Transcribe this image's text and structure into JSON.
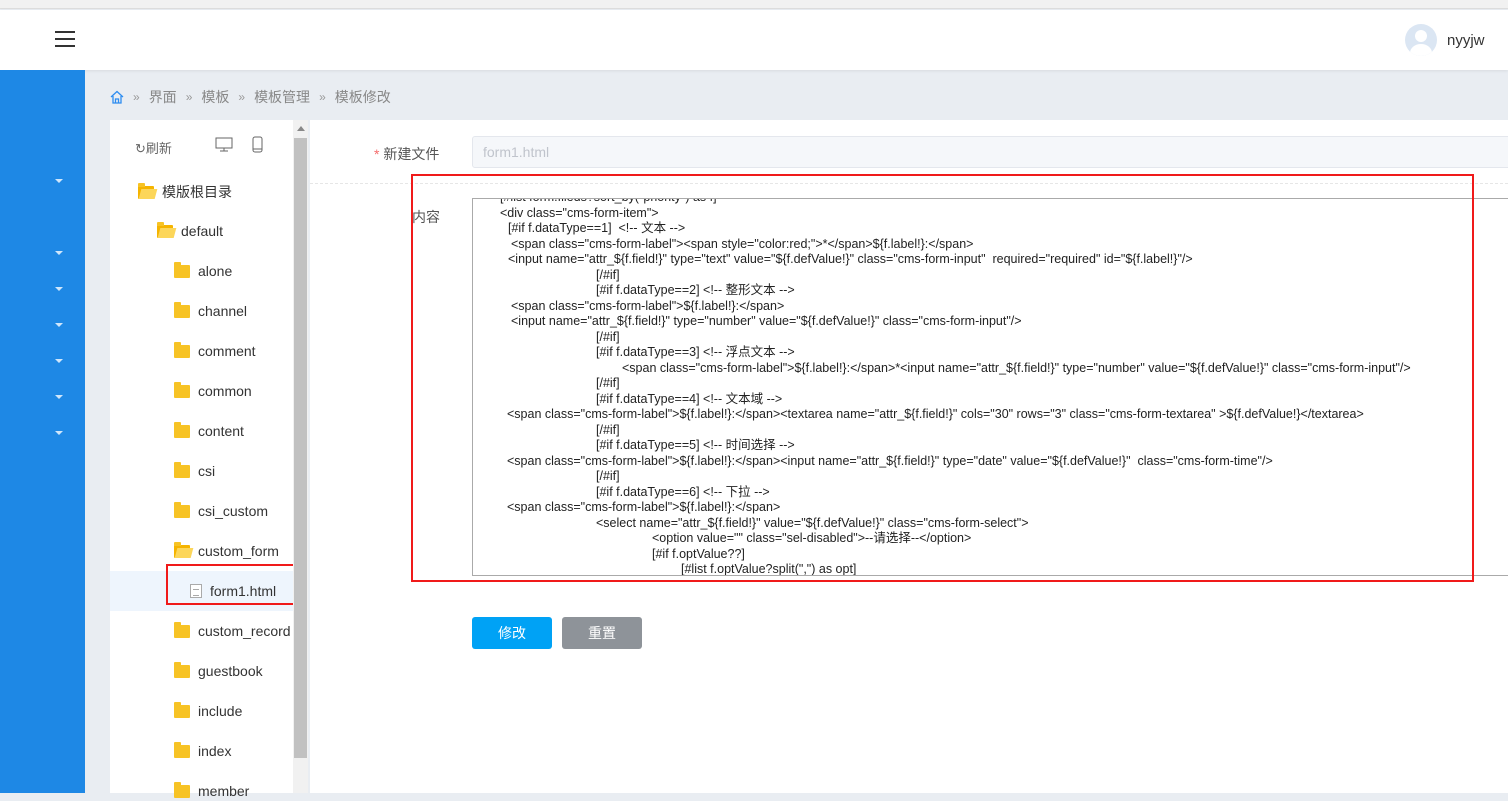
{
  "header": {
    "username": "nyyjw"
  },
  "breadcrumb": [
    "界面",
    "模板",
    "模板管理",
    "模板修改"
  ],
  "tree": {
    "refresh": "刷新",
    "root": "模版根目录",
    "default": "default",
    "items": [
      "alone",
      "channel",
      "comment",
      "common",
      "content",
      "csi",
      "csi_custom",
      "custom_form"
    ],
    "selected_file": "form1.html",
    "items_after": [
      "custom_record",
      "guestbook",
      "include",
      "index",
      "member"
    ]
  },
  "form": {
    "filename_label": "新建文件",
    "required_mark": "*",
    "filename_value": "form1.html",
    "content_label": "内容",
    "code_lines": [
      "[#list form.fileds?sort_by(\"priority\") as f]",
      "<div class=\"cms-form-item\">",
      "[#if f.dataType==1]  <!-- 文本 -->",
      "<span class=\"cms-form-label\"><span style=\"color:red;\">*</span>${f.label!}:</span>",
      "<input name=\"attr_${f.field!}\" type=\"text\" value=\"${f.defValue!}\" class=\"cms-form-input\"  required=\"required\" id=\"${f.label!}\"/>",
      "[/#if]",
      "[#if f.dataType==2] <!-- 整形文本 -->",
      "<span class=\"cms-form-label\">${f.label!}:</span>",
      "<input name=\"attr_${f.field!}\" type=\"number\" value=\"${f.defValue!}\" class=\"cms-form-input\"/>",
      "[/#if]",
      "[#if f.dataType==3] <!-- 浮点文本 -->",
      "<span class=\"cms-form-label\">${f.label!}:</span>*<input name=\"attr_${f.field!}\" type=\"number\" value=\"${f.defValue!}\" class=\"cms-form-input\"/>",
      "[/#if]",
      "[#if f.dataType==4] <!-- 文本域 -->",
      "<span class=\"cms-form-label\">${f.label!}:</span><textarea name=\"attr_${f.field!}\" cols=\"30\" rows=\"3\" class=\"cms-form-textarea\" >${f.defValue!}</textarea>",
      "[/#if]",
      "[#if f.dataType==5] <!-- 时间选择 -->",
      "<span class=\"cms-form-label\">${f.label!}:</span><input name=\"attr_${f.field!}\" type=\"date\" value=\"${f.defValue!}\"  class=\"cms-form-time\"/>",
      "[/#if]",
      "[#if f.dataType==6] <!-- 下拉 -->",
      "<span class=\"cms-form-label\">${f.label!}:</span>",
      "<select name=\"attr_${f.field!}\" value=\"${f.defValue!}\" class=\"cms-form-select\">",
      "<option value=\"\" class=\"sel-disabled\">--请选择--</option>",
      "[#if f.optValue??]",
      "[#list f.optValue?split(\",\") as opt]"
    ],
    "submit": "修改",
    "reset": "重置"
  },
  "colors": {
    "sidebar": "#1e88e5",
    "primary": "#00a2f5",
    "highlight": "#f01a1a"
  }
}
